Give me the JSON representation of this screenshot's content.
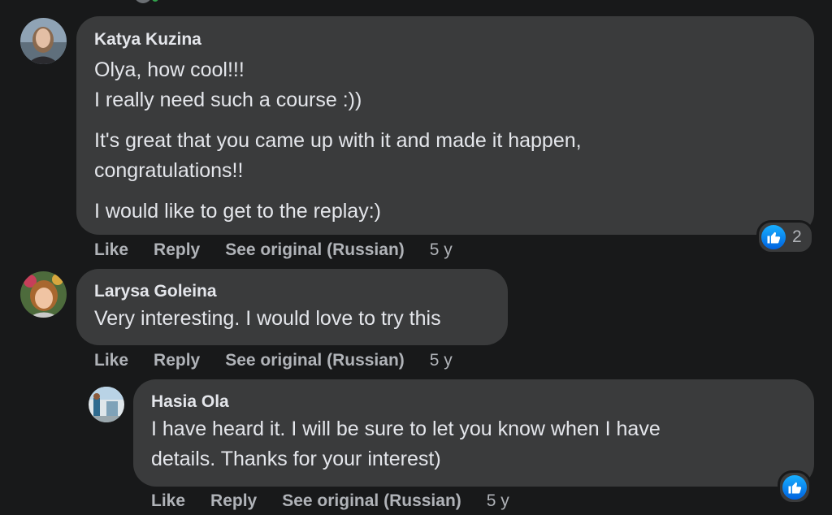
{
  "comments": [
    {
      "author": "Katya Kuzina",
      "lines_p1": [
        "Olya, how cool!!!",
        "I really need such a course :))"
      ],
      "lines_p2": [
        "It's great that you came up with it and made it happen,",
        "congratulations!!"
      ],
      "lines_p3": [
        "I would like to get to the replay:)"
      ],
      "actions": {
        "like": "Like",
        "reply": "Reply",
        "see_original": "See original (Russian)",
        "time": "5 y"
      },
      "reaction_count": "2"
    },
    {
      "author": "Larysa Goleina",
      "lines": [
        "Very interesting. I would love to try this"
      ],
      "actions": {
        "like": "Like",
        "reply": "Reply",
        "see_original": "See original (Russian)",
        "time": "5 y"
      }
    },
    {
      "author": "Hasia Ola",
      "lines": [
        "I have heard it. I will be sure to let you know when I have",
        "details. Thanks for your interest)"
      ],
      "actions": {
        "like": "Like",
        "reply": "Reply",
        "see_original": "See original (Russian)",
        "time": "5 y"
      }
    }
  ],
  "colors": {
    "background": "#18191a",
    "bubble": "#3a3b3c",
    "text_primary": "#e4e6eb",
    "text_secondary": "#b0b3b8",
    "like_blue": "#1877f2"
  },
  "icons": {
    "reaction": "thumbs-up-icon"
  }
}
